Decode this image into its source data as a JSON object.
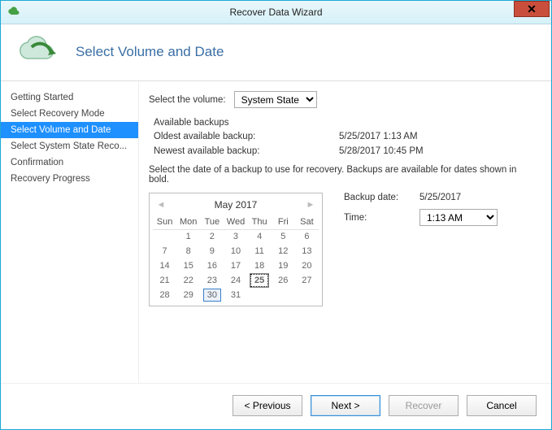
{
  "window": {
    "title": "Recover Data Wizard"
  },
  "header": {
    "title": "Select Volume and Date",
    "icon": "cloud-arrow-icon"
  },
  "sidebar": {
    "items": [
      {
        "label": "Getting Started",
        "selected": false
      },
      {
        "label": "Select Recovery Mode",
        "selected": false
      },
      {
        "label": "Select Volume and Date",
        "selected": true
      },
      {
        "label": "Select System State Reco...",
        "selected": false
      },
      {
        "label": "Confirmation",
        "selected": false
      },
      {
        "label": "Recovery Progress",
        "selected": false
      }
    ]
  },
  "main": {
    "volume_label": "Select the volume:",
    "volume_value": "System State",
    "group_label": "Available backups",
    "oldest_label": "Oldest available backup:",
    "oldest_value": "5/25/2017 1:13 AM",
    "newest_label": "Newest available backup:",
    "newest_value": "5/28/2017 10:45 PM",
    "instruction": "Select the date of a backup to use for recovery. Backups are available for dates shown in bold.",
    "backup_date_label": "Backup date:",
    "backup_date_value": "5/25/2017",
    "time_label": "Time:",
    "time_value": "1:13 AM",
    "calendar": {
      "month": "May 2017",
      "day_headers": [
        "Sun",
        "Mon",
        "Tue",
        "Wed",
        "Thu",
        "Fri",
        "Sat"
      ],
      "weeks": [
        [
          {
            "n": "",
            "dim": true
          },
          {
            "n": "1"
          },
          {
            "n": "2"
          },
          {
            "n": "3"
          },
          {
            "n": "4"
          },
          {
            "n": "5"
          },
          {
            "n": "6"
          }
        ],
        [
          {
            "n": "7"
          },
          {
            "n": "8"
          },
          {
            "n": "9"
          },
          {
            "n": "10"
          },
          {
            "n": "11"
          },
          {
            "n": "12"
          },
          {
            "n": "13"
          }
        ],
        [
          {
            "n": "14"
          },
          {
            "n": "15"
          },
          {
            "n": "16"
          },
          {
            "n": "17"
          },
          {
            "n": "18"
          },
          {
            "n": "19"
          },
          {
            "n": "20"
          }
        ],
        [
          {
            "n": "21"
          },
          {
            "n": "22"
          },
          {
            "n": "23"
          },
          {
            "n": "24"
          },
          {
            "n": "25",
            "bold": true,
            "selected": true
          },
          {
            "n": "26"
          },
          {
            "n": "27"
          }
        ],
        [
          {
            "n": "28",
            "bold": true
          },
          {
            "n": "29"
          },
          {
            "n": "30",
            "today": true
          },
          {
            "n": "31"
          },
          {
            "n": ""
          },
          {
            "n": ""
          },
          {
            "n": ""
          }
        ]
      ]
    }
  },
  "footer": {
    "previous": "< Previous",
    "next": "Next >",
    "recover": "Recover",
    "cancel": "Cancel",
    "recover_enabled": false
  }
}
